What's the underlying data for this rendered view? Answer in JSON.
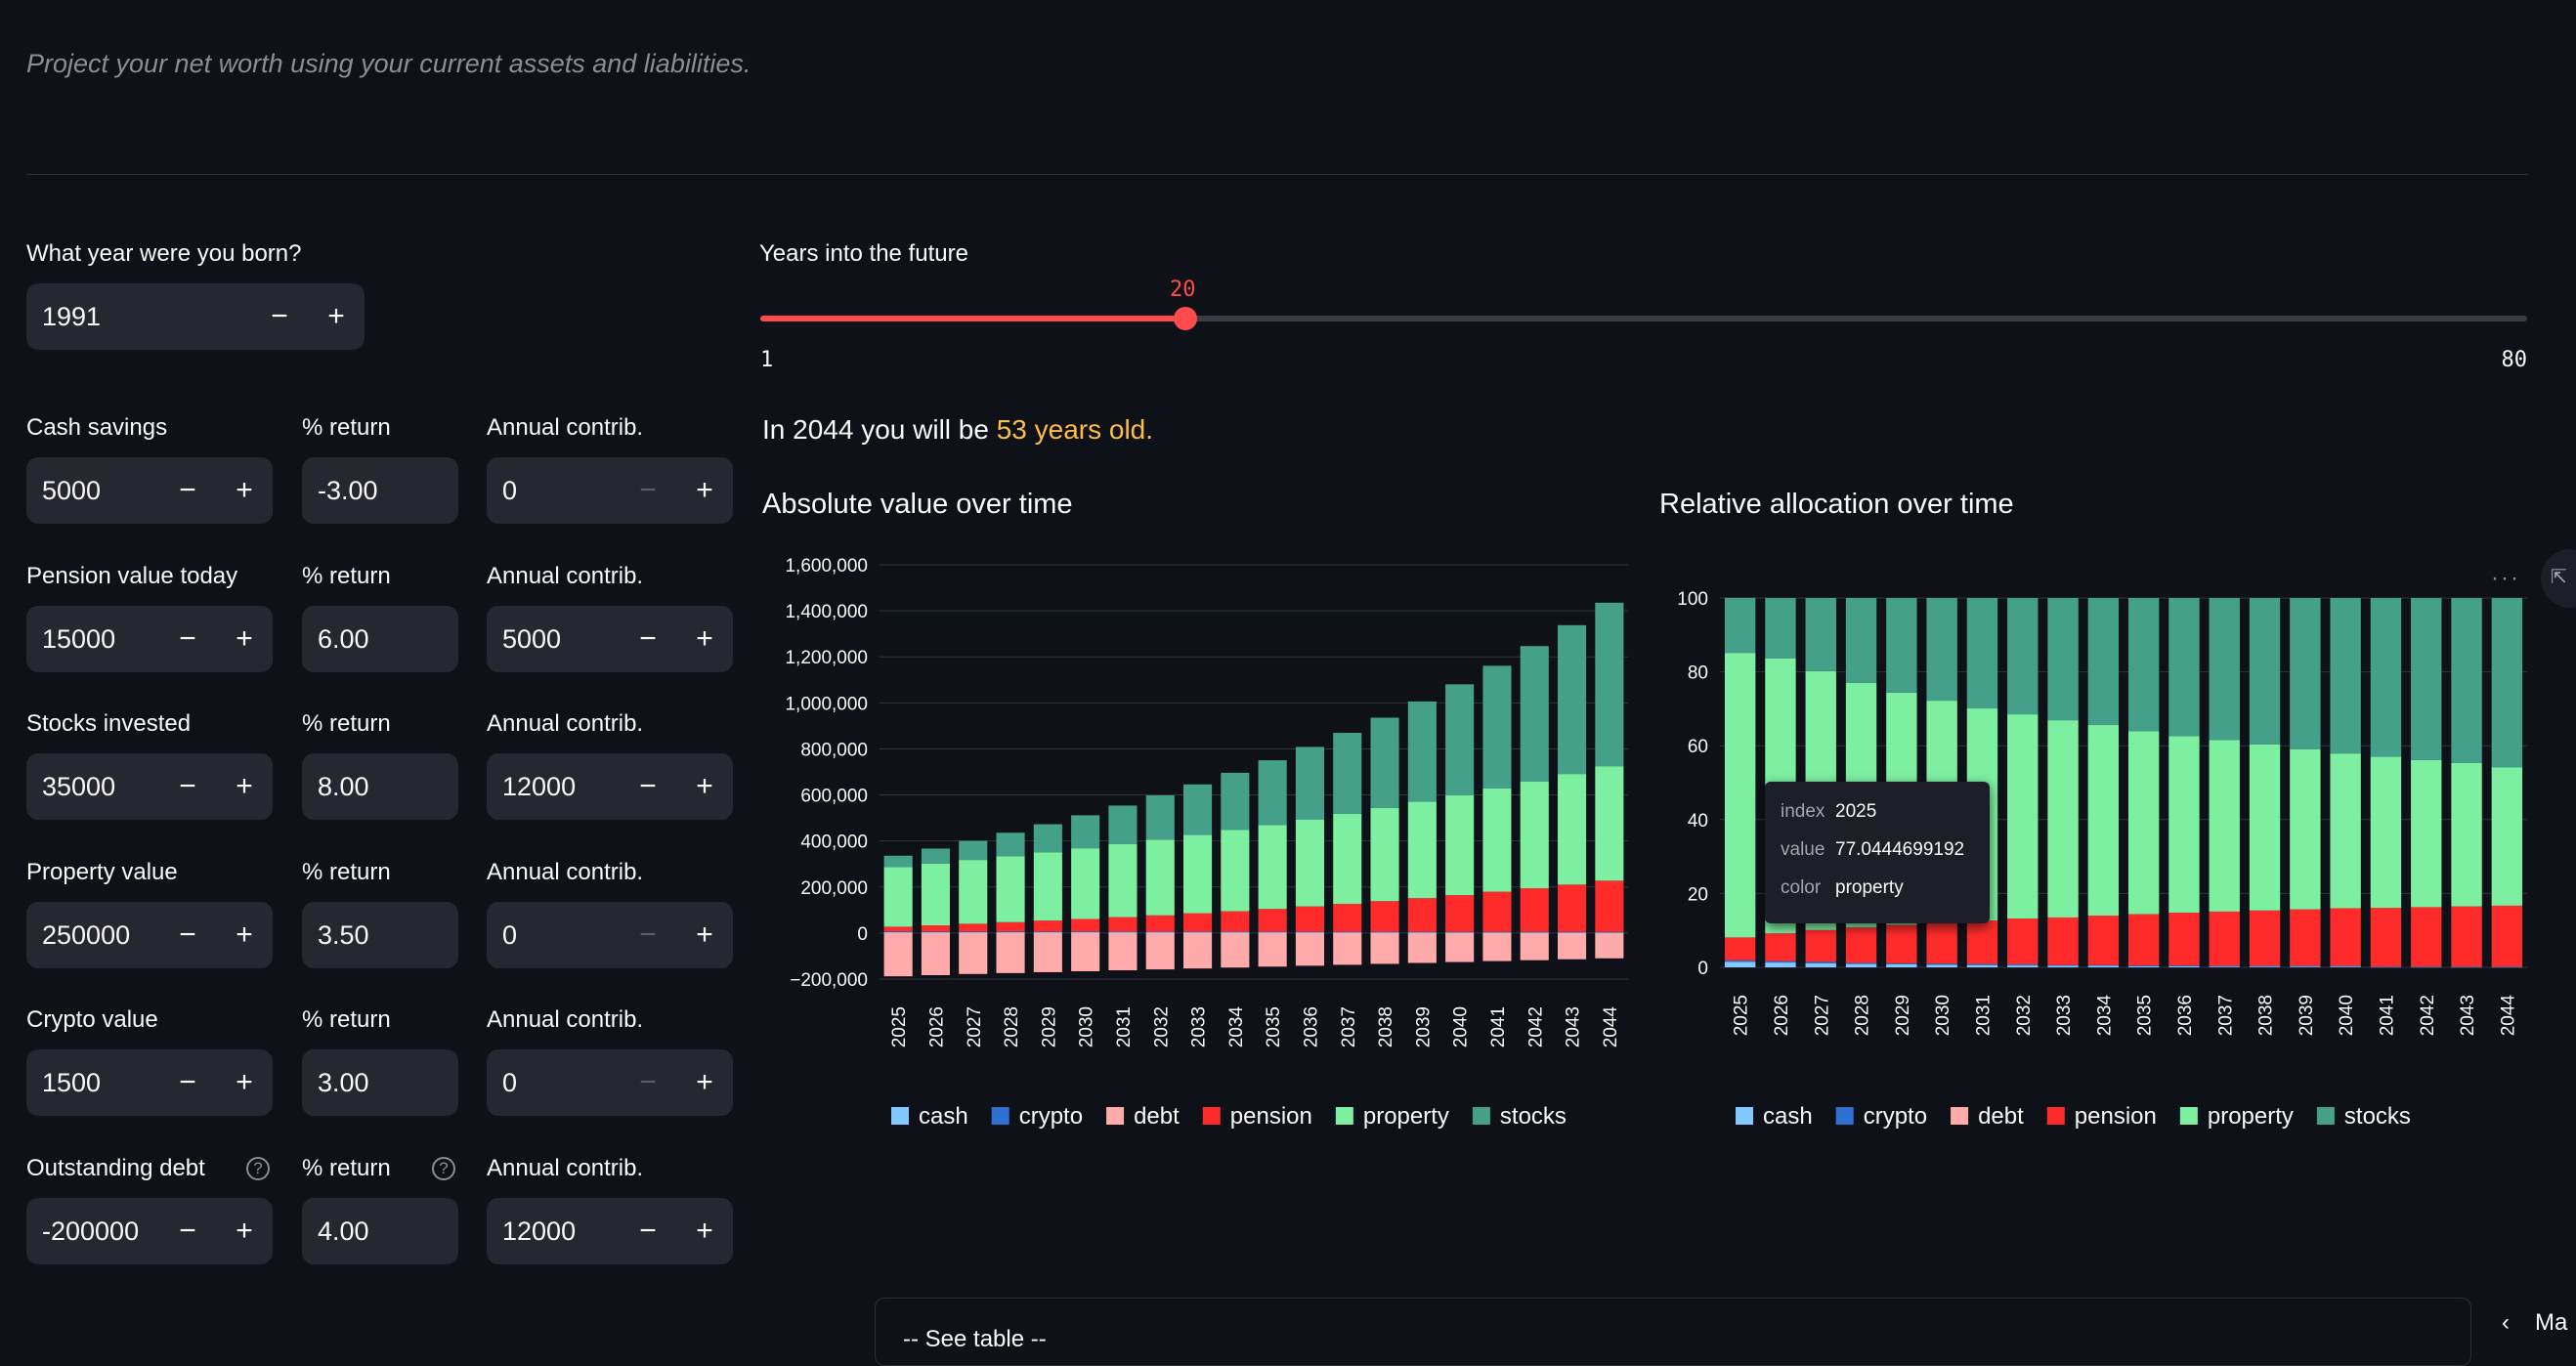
{
  "subtitle": "Project your net worth using your current assets and liabilities.",
  "born": {
    "label": "What year were you born?",
    "value": "1991"
  },
  "stepper": {
    "minus": "−",
    "plus": "+"
  },
  "years_slider": {
    "label": "Years into the future",
    "value": "20",
    "min": "1",
    "max": "80",
    "fraction": 0.2405
  },
  "rows": [
    {
      "asset_label": "Cash savings",
      "asset_value": "5000",
      "return_label": "% return",
      "return_value": "-3.00",
      "contrib_label": "Annual contrib.",
      "contrib_value": "0"
    },
    {
      "asset_label": "Pension value today",
      "asset_value": "15000",
      "return_label": "% return",
      "return_value": "6.00",
      "contrib_label": "Annual contrib.",
      "contrib_value": "5000"
    },
    {
      "asset_label": "Stocks invested",
      "asset_value": "35000",
      "return_label": "% return",
      "return_value": "8.00",
      "contrib_label": "Annual contrib.",
      "contrib_value": "12000"
    },
    {
      "asset_label": "Property value",
      "asset_value": "250000",
      "return_label": "% return",
      "return_value": "3.50",
      "contrib_label": "Annual contrib.",
      "contrib_value": "0"
    },
    {
      "asset_label": "Crypto value",
      "asset_value": "1500",
      "return_label": "% return",
      "return_value": "3.00",
      "contrib_label": "Annual contrib.",
      "contrib_value": "0"
    },
    {
      "asset_label": "Outstanding debt",
      "asset_value": "-200000",
      "return_label": "% return",
      "return_value": "4.00",
      "contrib_label": "Annual contrib.",
      "contrib_value": "12000"
    }
  ],
  "help_glyph": "?",
  "summary": {
    "prefix": "In 2044 you will be ",
    "highlight": "53 years old."
  },
  "charts_titles": {
    "absolute": "Absolute value over time",
    "relative": "Relative allocation over time"
  },
  "tooltip": {
    "k1": "index",
    "v1": "2025",
    "k2": "value",
    "v2": "77.0444699192",
    "k3": "color",
    "v3": "property"
  },
  "expander_label": "-- See table --",
  "more_glyph": "···",
  "side_tab_glyph": "⇱",
  "bottom_ctrl": {
    "chevron": "‹",
    "text": "Ma"
  },
  "colors": {
    "accent": "#ff4b4b",
    "highlight": "#ffbd45",
    "cash": "#83c9ff",
    "crypto": "#2e6fd4",
    "debt": "#ffabab",
    "pension": "#ff2b2b",
    "property": "#7defa1",
    "stocks": "#45a08a"
  },
  "chart_data": [
    {
      "type": "bar",
      "stacked": true,
      "title": "Absolute value over time",
      "categories": [
        "2025",
        "2026",
        "2027",
        "2028",
        "2029",
        "2030",
        "2031",
        "2032",
        "2033",
        "2034",
        "2035",
        "2036",
        "2037",
        "2038",
        "2039",
        "2040",
        "2041",
        "2042",
        "2043",
        "2044"
      ],
      "ylim": [
        -200000,
        1600000
      ],
      "yticks": [
        -200000,
        0,
        200000,
        400000,
        600000,
        800000,
        1000000,
        1200000,
        1400000,
        1600000
      ],
      "ytick_labels": [
        "−200,000",
        "0",
        "200,000",
        "400,000",
        "600,000",
        "800,000",
        "1,000,000",
        "1,200,000",
        "1,400,000",
        "1,600,000"
      ],
      "legend": "bottom",
      "series": [
        {
          "name": "cash",
          "values": [
            5000,
            4850,
            4700,
            4560,
            4420,
            4290,
            4160,
            4040,
            3920,
            3800,
            3690,
            3580,
            3470,
            3370,
            3270,
            3170,
            3070,
            2980,
            2890,
            2800
          ]
        },
        {
          "name": "crypto",
          "values": [
            1500,
            1550,
            1590,
            1640,
            1690,
            1740,
            1790,
            1840,
            1900,
            1960,
            2020,
            2080,
            2140,
            2200,
            2270,
            2340,
            2410,
            2480,
            2550,
            2630
          ]
        },
        {
          "name": "debt",
          "values": [
            -188000,
            -183000,
            -178000,
            -174000,
            -170000,
            -166000,
            -162000,
            -158000,
            -154000,
            -150000,
            -146000,
            -142000,
            -138000,
            -134000,
            -130000,
            -126000,
            -122000,
            -118000,
            -114000,
            -110000
          ]
        },
        {
          "name": "pension",
          "values": [
            21000,
            27000,
            34000,
            41000,
            48000,
            55000,
            63000,
            71000,
            80000,
            89000,
            99000,
            110000,
            121000,
            133000,
            146000,
            159000,
            174000,
            189000,
            205000,
            222000
          ]
        },
        {
          "name": "property",
          "values": [
            258750,
            267800,
            277200,
            286900,
            296900,
            307300,
            318100,
            329200,
            340700,
            352600,
            365000,
            377800,
            391000,
            404700,
            418800,
            433500,
            448600,
            464400,
            480600,
            497400
          ]
        },
        {
          "name": "stocks",
          "values": [
            49800,
            65800,
            83000,
            101600,
            121700,
            143400,
            166800,
            192100,
            219400,
            248900,
            280800,
            315200,
            352300,
            392400,
            435800,
            482600,
            533100,
            587700,
            646600,
            710300
          ]
        }
      ]
    },
    {
      "type": "bar",
      "stacked": true,
      "title": "Relative allocation over time",
      "categories": [
        "2025",
        "2026",
        "2027",
        "2028",
        "2029",
        "2030",
        "2031",
        "2032",
        "2033",
        "2034",
        "2035",
        "2036",
        "2037",
        "2038",
        "2039",
        "2040",
        "2041",
        "2042",
        "2043",
        "2044"
      ],
      "ylim": [
        0,
        100
      ],
      "yticks": [
        0,
        20,
        40,
        60,
        80,
        100
      ],
      "legend": "bottom",
      "series": [
        {
          "name": "cash",
          "values": [
            1.5,
            1.3,
            1.1,
            0.9,
            0.8,
            0.7,
            0.6,
            0.5,
            0.4,
            0.4,
            0.3,
            0.3,
            0.2,
            0.2,
            0.2,
            0.2,
            0.1,
            0.1,
            0.1,
            0.1
          ]
        },
        {
          "name": "crypto",
          "values": [
            0.4,
            0.4,
            0.4,
            0.3,
            0.3,
            0.3,
            0.3,
            0.3,
            0.2,
            0.2,
            0.2,
            0.2,
            0.2,
            0.2,
            0.2,
            0.2,
            0.1,
            0.1,
            0.1,
            0.1
          ]
        },
        {
          "name": "debt",
          "values": [
            0,
            0,
            0,
            0,
            0,
            0,
            0,
            0,
            0,
            0,
            0,
            0,
            0,
            0,
            0,
            0,
            0,
            0,
            0,
            0
          ]
        },
        {
          "name": "pension",
          "values": [
            6.2,
            7.5,
            8.6,
            9.6,
            10.4,
            11.1,
            11.8,
            12.4,
            12.9,
            13.4,
            13.9,
            14.3,
            14.7,
            15.0,
            15.3,
            15.6,
            15.9,
            16.1,
            16.3,
            16.5
          ]
        },
        {
          "name": "property",
          "values": [
            77.0444699192,
            74.4,
            70.1,
            66.2,
            62.9,
            60.1,
            57.4,
            55.3,
            53.4,
            51.6,
            49.5,
            47.8,
            46.4,
            45.0,
            43.3,
            41.9,
            40.9,
            39.8,
            38.8,
            37.4
          ]
        },
        {
          "name": "stocks",
          "values": [
            14.9,
            16.4,
            19.8,
            23.0,
            25.6,
            27.8,
            29.9,
            31.5,
            33.1,
            34.4,
            36.1,
            37.4,
            38.5,
            39.6,
            41.0,
            42.1,
            43.0,
            43.9,
            44.7,
            45.9
          ]
        }
      ]
    }
  ]
}
